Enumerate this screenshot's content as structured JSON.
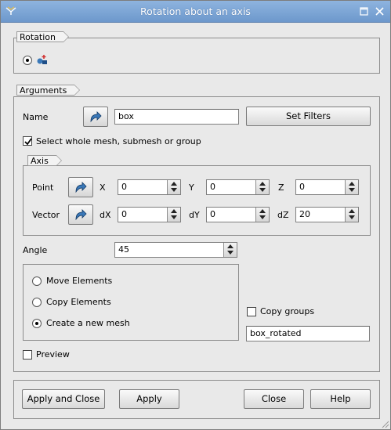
{
  "window": {
    "title": "Rotation about an axis"
  },
  "rotation_group": {
    "label": "Rotation",
    "icon": "rotation-axis-icon"
  },
  "arguments_group": {
    "label": "Arguments",
    "name_label": "Name",
    "name_value": "box",
    "set_filters": "Set Filters",
    "select_whole_mesh": "Select whole mesh, submesh or group",
    "select_whole_mesh_checked": true
  },
  "axis_group": {
    "label": "Axis",
    "point_label": "Point",
    "vector_label": "Vector",
    "x_label": "X",
    "x_value": "0",
    "y_label": "Y",
    "y_value": "0",
    "z_label": "Z",
    "z_value": "0",
    "dx_label": "dX",
    "dx_value": "0",
    "dy_label": "dY",
    "dy_value": "0",
    "dz_label": "dZ",
    "dz_value": "20"
  },
  "angle": {
    "label": "Angle",
    "value": "45"
  },
  "mode": {
    "options": [
      "Move Elements",
      "Copy Elements",
      "Create a new mesh"
    ],
    "selected": "Create a new mesh"
  },
  "copy_groups": {
    "label": "Copy groups",
    "checked": false
  },
  "new_mesh_name": "box_rotated",
  "preview": {
    "label": "Preview",
    "checked": false
  },
  "buttons": {
    "apply_close": "Apply and Close",
    "apply": "Apply",
    "close": "Close",
    "help": "Help"
  },
  "colors": {
    "titlebar": "#7aa3d6",
    "background": "#e9e9e9",
    "selection_icon": "#3a78b8"
  }
}
